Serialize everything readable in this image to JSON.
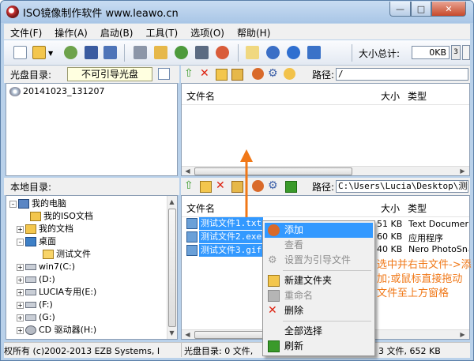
{
  "window": {
    "title": "ISO镜像制作软件 www.leawo.cn"
  },
  "menu": [
    "文件(F)",
    "操作(A)",
    "启动(B)",
    "工具(T)",
    "选项(O)",
    "帮助(H)"
  ],
  "toolbar": {
    "total_label": "大小总计:",
    "total_value": "0KB",
    "spin": "3"
  },
  "disc_pane": {
    "label": "光盘目录:",
    "disc_name": "不可引导光盘",
    "tree_root": "20141023_131207",
    "path_label": "路径:",
    "path_value": "/",
    "columns": {
      "name": "文件名",
      "size": "大小",
      "type": "类型"
    }
  },
  "local_pane": {
    "label": "本地目录:",
    "tree": [
      {
        "label": "我的电脑",
        "icon": "computer-icon"
      },
      {
        "label": "我的ISO文档",
        "icon": "folder-icon"
      },
      {
        "label": "我的文档",
        "icon": "folder-icon"
      },
      {
        "label": "桌面",
        "icon": "desktop-icon"
      },
      {
        "label": "测试文件",
        "icon": "folder-open-icon"
      },
      {
        "label": "win7(C:)",
        "icon": "drive-icon"
      },
      {
        "label": "(D:)",
        "icon": "drive-icon"
      },
      {
        "label": "LUCIA专用(E:)",
        "icon": "drive-icon"
      },
      {
        "label": "(F:)",
        "icon": "drive-icon"
      },
      {
        "label": "(G:)",
        "icon": "drive-icon"
      },
      {
        "label": "CD 驱动器(H:)",
        "icon": "cd-drive-icon"
      }
    ],
    "path_label": "路径:",
    "path_value": "C:\\Users\\Lucia\\Desktop\\测试",
    "columns": {
      "name": "文件名",
      "size": "大小",
      "type": "类型"
    },
    "files": [
      {
        "name": "测试文件1.txt",
        "size": "51 KB",
        "type": "Text Document"
      },
      {
        "name": "测试文件2.exe",
        "size": "60 KB",
        "type": "应用程序"
      },
      {
        "name": "测试文件3.gif",
        "size": "40 KB",
        "type": "Nero PhotoSnap"
      }
    ]
  },
  "context_menu": {
    "items": [
      {
        "label": "添加",
        "state": "highlighted"
      },
      {
        "label": "查看",
        "state": "disabled"
      },
      {
        "label": "设置为引导文件",
        "state": "disabled"
      },
      {
        "label": "新建文件夹",
        "state": "normal"
      },
      {
        "label": "重命名",
        "state": "disabled"
      },
      {
        "label": "删除",
        "state": "normal"
      },
      {
        "label": "全部选择",
        "state": "normal"
      },
      {
        "label": "刷新",
        "state": "normal"
      }
    ]
  },
  "status": {
    "left": "权所有 (c)2002-2013 EZB Systems, I",
    "mid": "光盘目录: 0 文件,",
    "right": "3 文件, 652 KB"
  },
  "annotation": "选中并右击文件->添加;或鼠标直接拖动文件至上方窗格",
  "colors": {
    "accent": "#3399ff",
    "annotation": "#f07818",
    "arrow": "#f07818"
  }
}
